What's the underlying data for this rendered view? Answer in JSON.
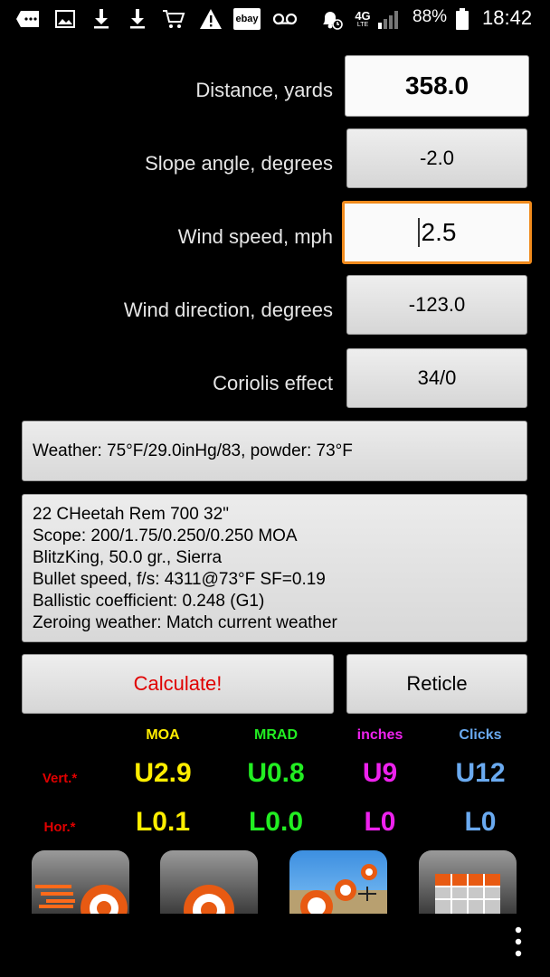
{
  "status_bar": {
    "icons": [
      "messages-icon",
      "image-icon",
      "download-icon",
      "download-icon",
      "cart-icon",
      "warning-icon",
      "ebay-icon",
      "voicemail-icon",
      "alarm-icon",
      "4g-lte-icon",
      "signal-icon",
      "battery-icon"
    ],
    "ebay_label": "ebay",
    "network_label": "4G",
    "lte_label": "LTE",
    "battery_percent": "88%",
    "time": "18:42"
  },
  "inputs": {
    "distance": {
      "label": "Distance, yards",
      "value": "358.0"
    },
    "slope": {
      "label": "Slope angle, degrees",
      "value": "-2.0"
    },
    "wind_speed": {
      "label": "Wind speed, mph",
      "value": "2.5"
    },
    "wind_direction": {
      "label": "Wind direction, degrees",
      "value": "-123.0"
    },
    "coriolis": {
      "label": "Coriolis effect",
      "value": "34/0"
    }
  },
  "weather": {
    "text": "Weather: 75°F/29.0inHg/83, powder: 73°F"
  },
  "profile": {
    "lines": [
      "22 CHeetah Rem 700 32\"",
      "Scope: 200/1.75/0.250/0.250 MOA",
      "BlitzKing, 50.0 gr., Sierra",
      "Bullet speed, f/s: 4311@73°F SF=0.19",
      "Ballistic coefficient: 0.248 (G1)",
      "Zeroing weather: Match current weather"
    ]
  },
  "buttons": {
    "calculate": "Calculate!",
    "reticle": "Reticle"
  },
  "results": {
    "headers": {
      "moa": "MOA",
      "mrad": "MRAD",
      "inches": "inches",
      "clicks": "Clicks"
    },
    "row_labels": {
      "vert": "Vert.*",
      "hor": "Hor.*"
    },
    "vert": {
      "moa": "U2.9",
      "mrad": "U0.8",
      "inches": "U9",
      "clicks": "U12"
    },
    "hor": {
      "moa": "L0.1",
      "mrad": "L0.0",
      "inches": "L0",
      "clicks": "L0"
    }
  },
  "colors": {
    "moa": "#ffee00",
    "mrad": "#22ee22",
    "inches": "#ee22ee",
    "clicks": "#6aaaf0",
    "row_label": "#e00000",
    "calculate": "#e00000",
    "focus_border": "#f08a1c"
  },
  "bottom_tiles": [
    "speed-target-icon",
    "target-icon",
    "range-scene-icon",
    "ammo-box-icon"
  ],
  "overflow_menu": "more-vert-icon"
}
